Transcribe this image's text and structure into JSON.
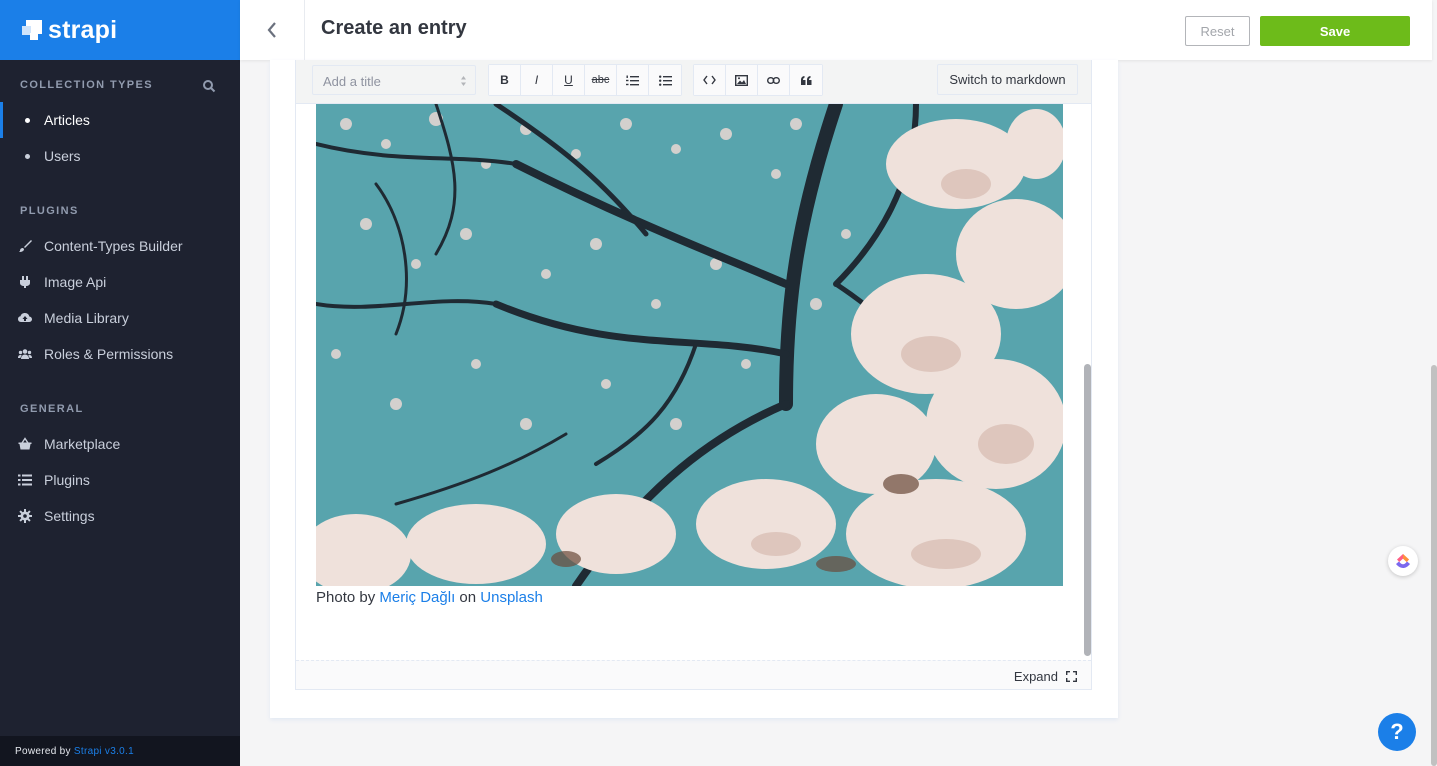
{
  "brand": {
    "name": "strapi",
    "color": "#1b7fe8"
  },
  "sidebar": {
    "collection_types_label": "COLLECTION TYPES",
    "collection_types": [
      {
        "label": "Articles",
        "active": true
      },
      {
        "label": "Users",
        "active": false
      }
    ],
    "plugins_label": "PLUGINS",
    "plugins": [
      {
        "label": "Content-Types Builder",
        "icon": "paintbrush-icon"
      },
      {
        "label": "Image Api",
        "icon": "plug-icon"
      },
      {
        "label": "Media Library",
        "icon": "cloud-upload-icon"
      },
      {
        "label": "Roles & Permissions",
        "icon": "users-icon"
      }
    ],
    "general_label": "GENERAL",
    "general": [
      {
        "label": "Marketplace",
        "icon": "basket-icon"
      },
      {
        "label": "Plugins",
        "icon": "list-icon"
      },
      {
        "label": "Settings",
        "icon": "gear-icon"
      }
    ],
    "powered_prefix": "Powered by",
    "powered_link": "Strapi v3.0.1"
  },
  "header": {
    "title": "Create an entry",
    "reset_label": "Reset",
    "save_label": "Save",
    "save_color": "#6dbb1a"
  },
  "editor": {
    "title_select_placeholder": "Add a title",
    "toolbar_buttons": [
      "B",
      "I",
      "U",
      "abc"
    ],
    "switch_label": "Switch to markdown",
    "caption": {
      "prefix": "Photo by",
      "author": "Meriç Dağlı",
      "middle": "on",
      "source": "Unsplash"
    },
    "expand_label": "Expand"
  },
  "help_label": "?"
}
